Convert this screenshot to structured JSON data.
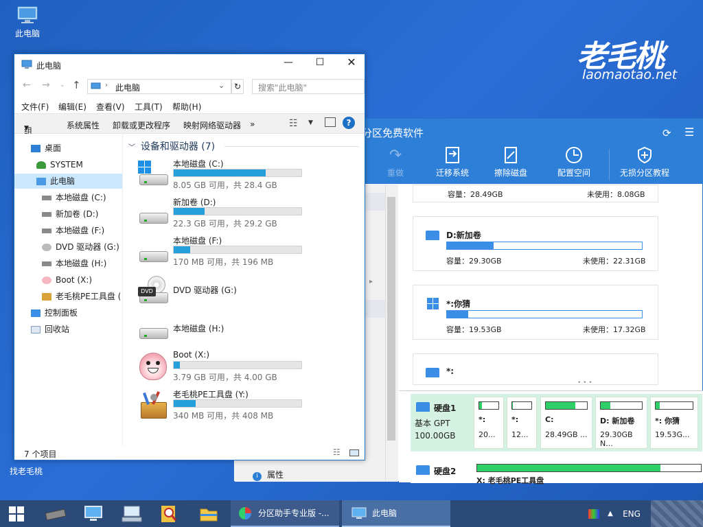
{
  "desktop": {
    "icons": [
      {
        "label": "此电脑"
      },
      {
        "label": "找老毛桃"
      }
    ],
    "logo_cn": "老毛桃",
    "logo_en": "laomaotao.net"
  },
  "partition_app": {
    "title_fragment": "分区免费软件",
    "toolbar": [
      {
        "label": "重做",
        "icon": "redo-icon",
        "enabled": false
      },
      {
        "label": "迁移系统",
        "icon": "migrate-icon",
        "enabled": true
      },
      {
        "label": "擦除磁盘",
        "icon": "wipe-icon",
        "enabled": true
      },
      {
        "label": "配置空间",
        "icon": "clock-icon",
        "enabled": true
      },
      {
        "label": "无损分区教程",
        "icon": "shield-icon",
        "enabled": true
      }
    ],
    "partitions": [
      {
        "name": "",
        "capacity": "容量：28.49GB",
        "unused": "未使用：8.08GB",
        "fill": 0.72
      },
      {
        "name": "D:新加卷",
        "capacity": "容量：29.30GB",
        "unused": "未使用：22.31GB",
        "fill": 0.24
      },
      {
        "name": "*:你猜",
        "capacity": "容量：19.53GB",
        "unused": "未使用：17.32GB",
        "fill": 0.11
      },
      {
        "name": "*:",
        "capacity": "",
        "unused": "",
        "fill": 0
      }
    ],
    "left_arrow": "▸",
    "properties_label": "属性",
    "disk1": {
      "name": "硬盘1",
      "type": "基本 GPT",
      "size": "100.00GB",
      "parts": [
        {
          "label": "*:",
          "size": "20...",
          "fill": 0.15
        },
        {
          "label": "*:",
          "size": "12...",
          "fill": 0.05
        },
        {
          "label": "C:",
          "size": "28.49GB ...",
          "fill": 0.72
        },
        {
          "label": "D: 新加卷",
          "size": "29.30GB N...",
          "fill": 0.24
        },
        {
          "label": "*: 你猜",
          "size": "19.53G...",
          "fill": 0.11
        }
      ]
    },
    "disk2": {
      "name": "硬盘2",
      "part_label": "X: 老毛桃PE工具盘"
    }
  },
  "explorer": {
    "title": "此电脑",
    "address_path": "此电脑",
    "search_placeholder": "搜索\"此电脑\"",
    "menu": [
      "文件(F)",
      "编辑(E)",
      "查看(V)",
      "工具(T)",
      "帮助(H)"
    ],
    "toolbar": [
      "组织",
      "系统属性",
      "卸载或更改程序",
      "映射网络驱动器",
      "»"
    ],
    "nav": [
      {
        "label": "桌面"
      },
      {
        "label": "SYSTEM"
      },
      {
        "label": "此电脑"
      },
      {
        "label": "本地磁盘 (C:)"
      },
      {
        "label": "新加卷 (D:)"
      },
      {
        "label": "本地磁盘 (F:)"
      },
      {
        "label": "DVD 驱动器 (G:)"
      },
      {
        "label": "本地磁盘 (H:)"
      },
      {
        "label": "Boot (X:)"
      },
      {
        "label": "老毛桃PE工具盘 ("
      },
      {
        "label": "控制面板"
      },
      {
        "label": "回收站"
      }
    ],
    "section_header": "设备和驱动器 (7)",
    "drives": [
      {
        "name": "本地磁盘 (C:)",
        "size": "8.05 GB 可用，共 28.4 GB",
        "fill": 0.72,
        "icon": "windows-drive-icon"
      },
      {
        "name": "新加卷 (D:)",
        "size": "22.3 GB 可用，共 29.2 GB",
        "fill": 0.24,
        "icon": "hard-drive-icon"
      },
      {
        "name": "本地磁盘 (F:)",
        "size": "170 MB 可用，共 196 MB",
        "fill": 0.13,
        "icon": "hard-drive-icon"
      },
      {
        "name": "DVD 驱动器 (G:)",
        "size": "",
        "fill": null,
        "icon": "dvd-drive-icon"
      },
      {
        "name": "本地磁盘 (H:)",
        "size": "",
        "fill": null,
        "icon": "hard-drive-icon"
      },
      {
        "name": "Boot (X:)",
        "size": "3.79 GB 可用，共 4.00 GB",
        "fill": 0.05,
        "icon": "peach-mascot-icon"
      },
      {
        "name": "老毛桃PE工具盘 (Y:)",
        "size": "340 MB 可用，共 408 MB",
        "fill": 0.17,
        "icon": "toolbox-icon"
      }
    ],
    "status": "7 个项目"
  },
  "taskbar": {
    "buttons": [
      {
        "label": "分区助手专业版 -..."
      },
      {
        "label": "此电脑"
      }
    ],
    "lang": "ENG"
  },
  "colors": {
    "desktop_blue": "#2a6ed6",
    "app_blue": "#2e7fd8",
    "progress_blue": "#26a0da",
    "partition_green": "#2fd06a",
    "taskbar": "#2c4a78"
  }
}
